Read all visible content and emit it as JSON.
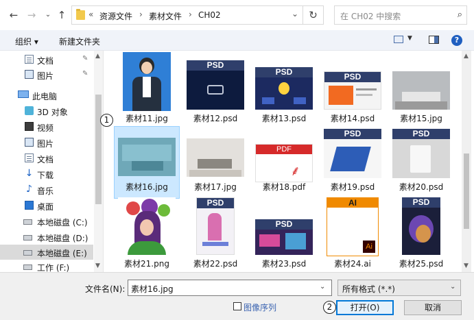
{
  "address_bar": {
    "overflow": "«",
    "crumbs": [
      "资源文件",
      "素材文件",
      "CH02"
    ],
    "search_placeholder": "在 CH02 中搜索"
  },
  "toolbar": {
    "organize": "组织",
    "new_folder": "新建文件夹"
  },
  "sidebar": {
    "items": [
      {
        "label": "文档",
        "icon": "document-icon",
        "pinned": true
      },
      {
        "label": "图片",
        "icon": "pictures-icon",
        "pinned": true
      },
      {
        "label": "此电脑",
        "icon": "this-pc-icon"
      },
      {
        "label": "3D 对象",
        "icon": "3d-objects-icon"
      },
      {
        "label": "视频",
        "icon": "video-icon"
      },
      {
        "label": "图片",
        "icon": "pictures-icon"
      },
      {
        "label": "文档",
        "icon": "document-icon"
      },
      {
        "label": "下载",
        "icon": "download-icon"
      },
      {
        "label": "音乐",
        "icon": "music-icon"
      },
      {
        "label": "桌面",
        "icon": "desktop-icon"
      },
      {
        "label": "本地磁盘 (C:)",
        "icon": "drive-icon"
      },
      {
        "label": "本地磁盘 (D:)",
        "icon": "drive-icon"
      },
      {
        "label": "本地磁盘 (E:)",
        "icon": "drive-icon",
        "selected": true
      },
      {
        "label": "工作 (F:)",
        "icon": "drive-icon"
      }
    ]
  },
  "files": [
    {
      "name": "素材11.jpg"
    },
    {
      "name": "素材12.psd"
    },
    {
      "name": "素材13.psd"
    },
    {
      "name": "素材14.psd"
    },
    {
      "name": "素材15.jpg"
    },
    {
      "name": "素材16.jpg",
      "selected": true
    },
    {
      "name": "素材17.jpg"
    },
    {
      "name": "素材18.pdf"
    },
    {
      "name": "素材19.psd"
    },
    {
      "name": "素材20.psd"
    },
    {
      "name": "素材21.png"
    },
    {
      "name": "素材22.psd"
    },
    {
      "name": "素材23.psd"
    },
    {
      "name": "素材24.ai"
    },
    {
      "name": "素材25.psd"
    }
  ],
  "thumb_labels": {
    "psd": "PSD",
    "pdf": "PDF",
    "ai": "AI",
    "ai_small": "Ai"
  },
  "bottom": {
    "filename_label": "文件名(N):",
    "filename_value": "素材16.jpg",
    "filetype_value": "所有格式 (*.*)",
    "sequence_label": "图像序列",
    "open_label": "打开(O)",
    "cancel_label": "取消"
  },
  "callouts": {
    "one": "1",
    "two": "2"
  },
  "colors": {
    "selection": "#cce8ff",
    "accent": "#0078d7",
    "psd_band": "#2f3f6b"
  }
}
